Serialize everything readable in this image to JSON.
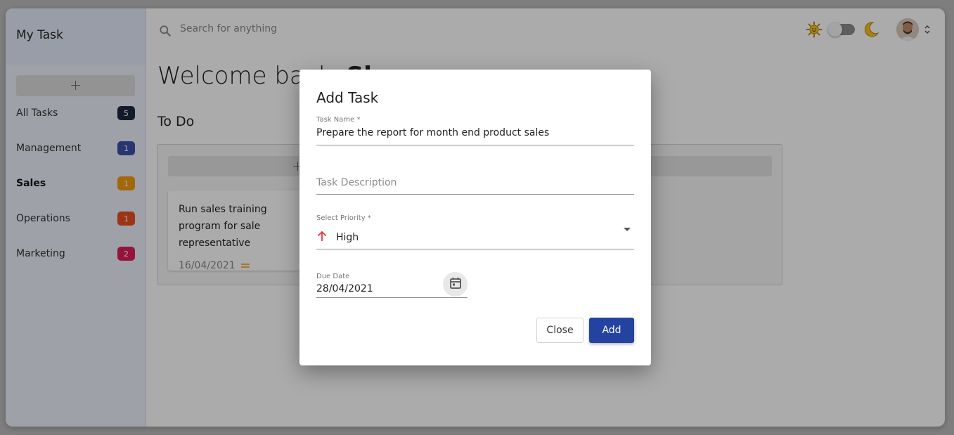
{
  "sidebar": {
    "title": "My Task",
    "add_label": "+",
    "items": [
      {
        "label": "All Tasks",
        "count": "5",
        "color": "#1d2741"
      },
      {
        "label": "Management",
        "count": "1",
        "color": "#3d4fa8"
      },
      {
        "label": "Sales",
        "count": "1",
        "color": "#f39c12"
      },
      {
        "label": "Operations",
        "count": "1",
        "color": "#e8501e"
      },
      {
        "label": "Marketing",
        "count": "2",
        "color": "#e01e5a"
      }
    ]
  },
  "header": {
    "search_placeholder": "Search for anything",
    "theme_icons": [
      "sun-icon",
      "moon-icon"
    ]
  },
  "main": {
    "welcome_prefix": "Welcome back,",
    "welcome_name": "Sh",
    "column_title": "To Do",
    "column_add_label": "+",
    "task_card": {
      "title": "Run sales training program for sale representative",
      "date": "16/04/2021",
      "priority_icon": "equals-icon",
      "priority_color": "#f39c12"
    }
  },
  "dialog": {
    "title": "Add Task",
    "task_name_label": "Task Name *",
    "task_name_value": "Prepare the report for month end product sales",
    "description_placeholder": "Task Description",
    "priority_label": "Select Priority *",
    "priority_value": "High",
    "priority_color": "#e53935",
    "due_date_label": "Due Date",
    "due_date_value": "28/04/2021",
    "close_label": "Close",
    "add_label": "Add",
    "accent_color": "#2443a1"
  }
}
